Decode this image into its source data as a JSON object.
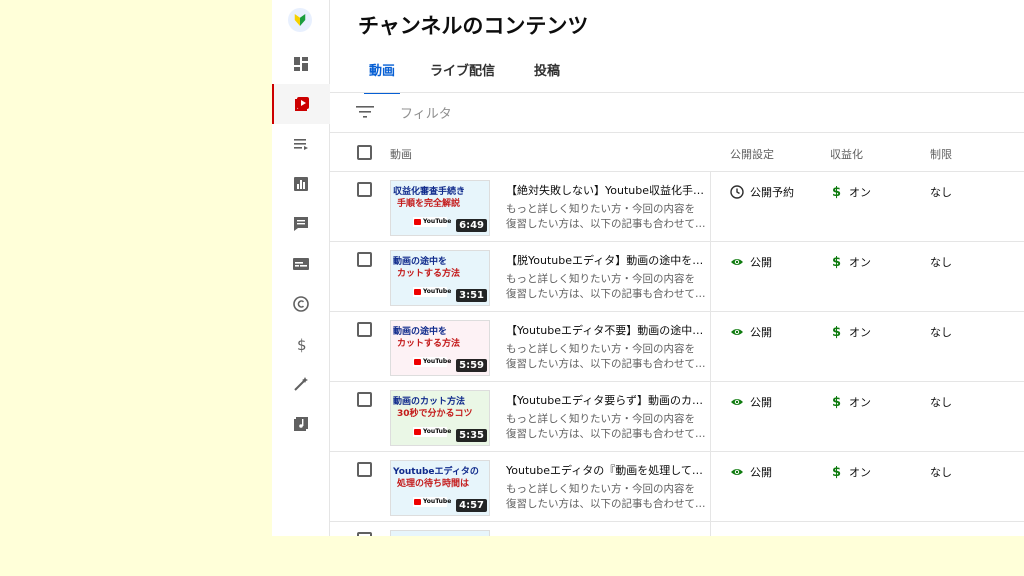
{
  "header": {
    "title": "チャンネルのコンテンツ"
  },
  "tabs": [
    {
      "label": "動画",
      "active": true
    },
    {
      "label": "ライブ配信",
      "active": false
    },
    {
      "label": "投稿",
      "active": false
    }
  ],
  "filter": {
    "placeholder": "フィルタ"
  },
  "columns": {
    "video": "動画",
    "visibility": "公開設定",
    "monetization": "収益化",
    "restrictions": "制限"
  },
  "sidebar": {
    "items": [
      {
        "icon": "dashboard-icon"
      },
      {
        "icon": "content-icon",
        "active": true
      },
      {
        "icon": "playlist-icon"
      },
      {
        "icon": "analytics-icon"
      },
      {
        "icon": "comments-icon"
      },
      {
        "icon": "subtitles-icon"
      },
      {
        "icon": "copyright-icon"
      },
      {
        "icon": "monetization-icon"
      },
      {
        "icon": "customization-icon"
      },
      {
        "icon": "audio-library-icon"
      }
    ]
  },
  "rows": [
    {
      "thumb_line1": "収益化審査手続き",
      "thumb_line2": "手順を完全解説",
      "thumb_badge": "YouTube",
      "duration": "6:49",
      "title": "【絶対失敗しない】Youtube収益化手…",
      "desc1": "もっと詳しく知りたい方・今回の内容を",
      "desc2": "復習したい方は、以下の記事も合わせて…",
      "visibility": "公開予約",
      "visibility_icon": "clock-icon",
      "monetization": "オン",
      "restrictions": "なし"
    },
    {
      "thumb_line1": "動画の途中を",
      "thumb_line2": "カットする方法",
      "thumb_badge": "YouTube",
      "duration": "3:51",
      "title": "【脱Youtubeエディタ】動画の途中を…",
      "desc1": "もっと詳しく知りたい方・今回の内容を",
      "desc2": "復習したい方は、以下の記事も合わせて…",
      "visibility": "公開",
      "visibility_icon": "eye-icon",
      "monetization": "オン",
      "restrictions": "なし"
    },
    {
      "thumb_line1": "動画の途中を",
      "thumb_line2": "カットする方法",
      "thumb_badge": "YouTube",
      "duration": "5:59",
      "title": "【Youtubeエディタ不要】動画の途中…",
      "desc1": "もっと詳しく知りたい方・今回の内容を",
      "desc2": "復習したい方は、以下の記事も合わせて…",
      "visibility": "公開",
      "visibility_icon": "eye-icon",
      "monetization": "オン",
      "restrictions": "なし"
    },
    {
      "thumb_line1": "動画のカット方法",
      "thumb_line2": "30秒で分かるコツ",
      "thumb_badge": "YouTube",
      "duration": "5:35",
      "title": "【Youtubeエディタ要らず】動画のカ…",
      "desc1": "もっと詳しく知りたい方・今回の内容を",
      "desc2": "復習したい方は、以下の記事も合わせて…",
      "visibility": "公開",
      "visibility_icon": "eye-icon",
      "monetization": "オン",
      "restrictions": "なし"
    },
    {
      "thumb_line1": "Youtubeエディタの",
      "thumb_line2": "処理の待ち時間は",
      "thumb_badge": "YouTube",
      "duration": "4:57",
      "title": "Youtubeエディタの『動画を処理して…",
      "desc1": "もっと詳しく知りたい方・今回の内容を",
      "desc2": "復習したい方は、以下の記事も合わせて…",
      "visibility": "公開",
      "visibility_icon": "eye-icon",
      "monetization": "オン",
      "restrictions": "なし"
    }
  ]
}
